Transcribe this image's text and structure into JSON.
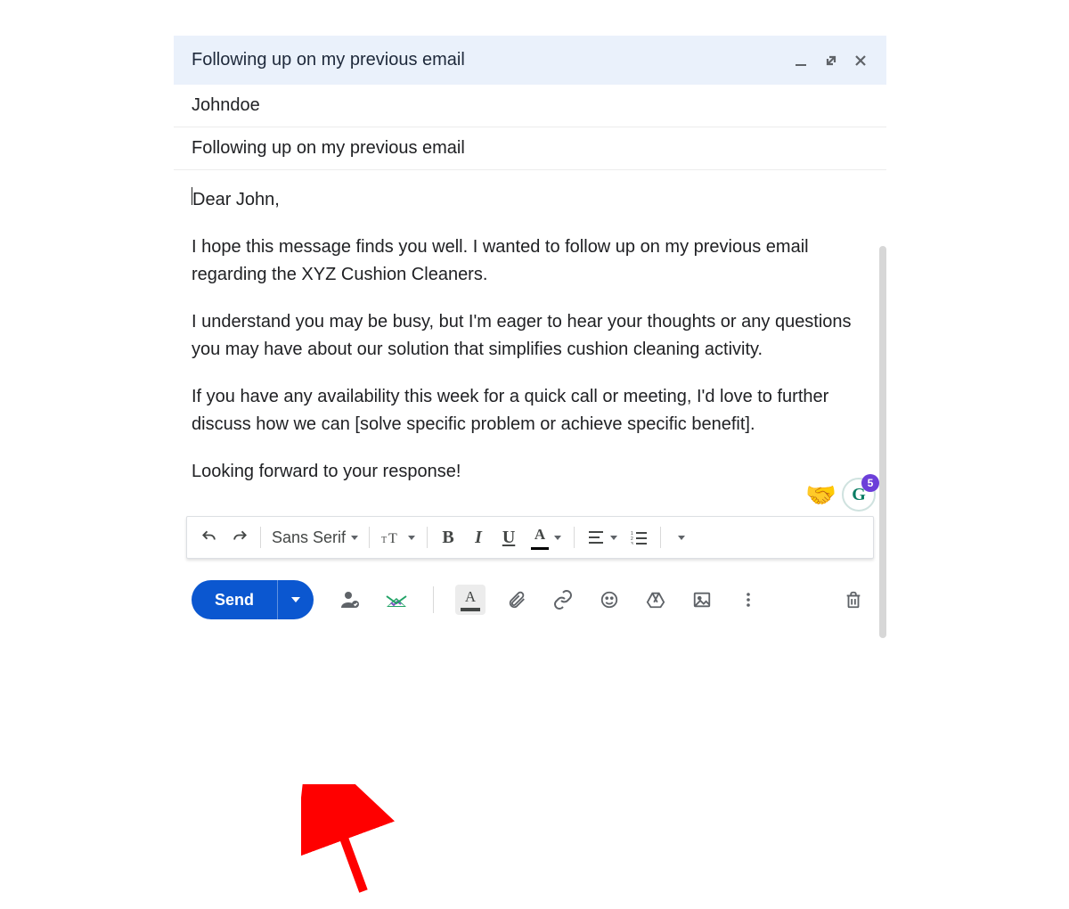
{
  "header": {
    "title": "Following up on my previous email"
  },
  "fields": {
    "to": "Johndoe",
    "subject": "Following up on my previous email"
  },
  "body": {
    "p1": "Dear John,",
    "p2": "I hope this message finds you well. I wanted to follow up on my previous email regarding the XYZ Cushion Cleaners.",
    "p3": "I understand you may be busy, but I'm eager to hear your thoughts or any questions you may have about our solution that simplifies cushion cleaning activity.",
    "p4": "If you have any availability this week for a quick call or meeting, I'd love to further discuss how we can [solve specific problem or achieve specific benefit].",
    "p5": "Looking forward to your response!"
  },
  "overlays": {
    "handshake": "🤝",
    "grammarly_badge": "5"
  },
  "format_toolbar": {
    "font_family": "Sans Serif"
  },
  "send_row": {
    "send_label": "Send"
  },
  "annotation": {
    "arrow_target": "send-options-dropdown"
  }
}
